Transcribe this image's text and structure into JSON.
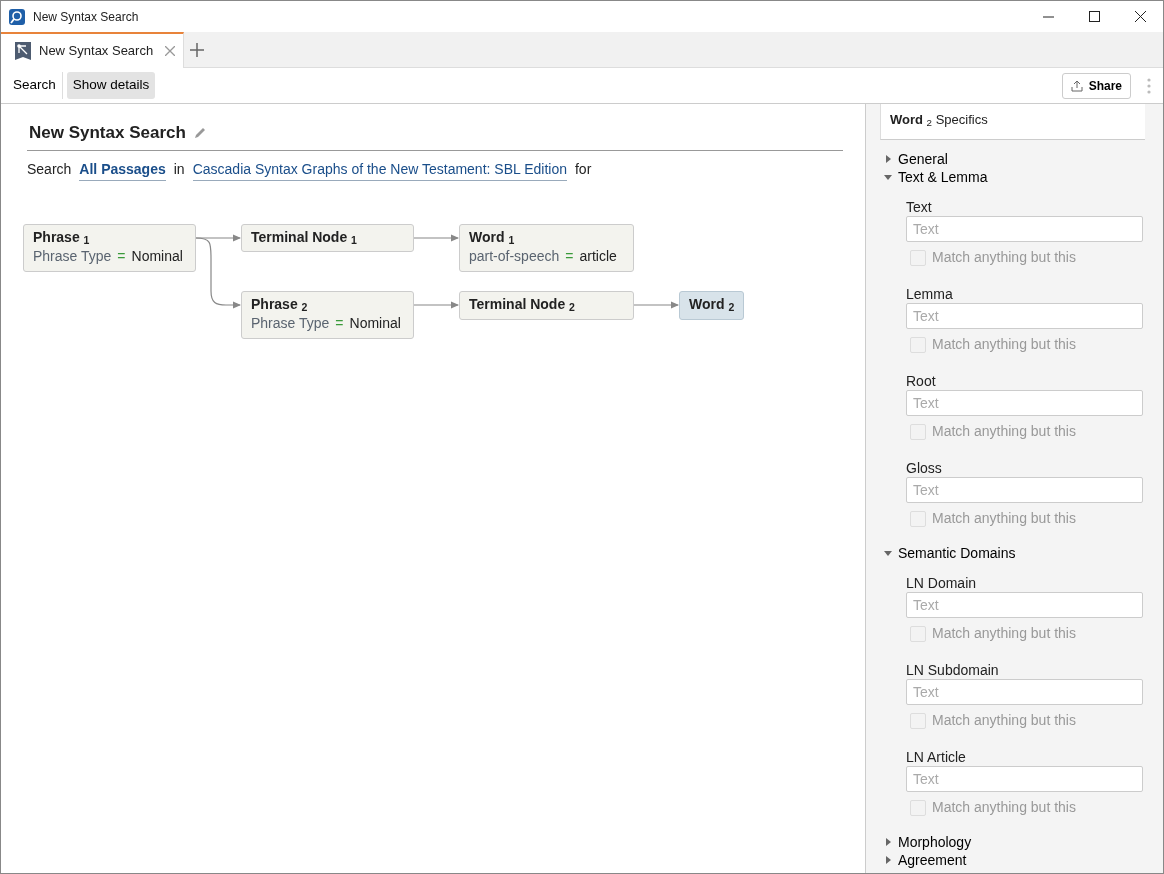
{
  "window": {
    "title": "New Syntax Search"
  },
  "tabs": [
    {
      "label": "New Syntax Search",
      "selected": true
    }
  ],
  "toolbar": {
    "items": [
      {
        "label": "Search",
        "selected": false
      },
      {
        "label": "Show details",
        "selected": true
      }
    ],
    "share": "Share"
  },
  "search": {
    "title": "New Syntax Search",
    "sentence": [
      {
        "kind": "text",
        "text": "Search"
      },
      {
        "kind": "link",
        "text": "All Passages",
        "bold": true
      },
      {
        "kind": "text",
        "text": "in"
      },
      {
        "kind": "link",
        "text": "Cascadia Syntax Graphs of the New Testament: SBL Edition",
        "bold": false
      },
      {
        "kind": "text",
        "text": "for"
      }
    ]
  },
  "graph": {
    "nodes": [
      {
        "title": "Phrase $_{1}$",
        "field": "Phrase Type",
        "op": "=",
        "value": "Nominal",
        "selected": false
      },
      {
        "title": "Terminal Node $_{1}$",
        "selected": false
      },
      {
        "title": "Word $_{1}$",
        "field": "part-of-speech",
        "op": "=",
        "value": "article",
        "selected": false
      },
      {
        "title": "Phrase $_{2}$",
        "field": "Phrase Type",
        "op": "=",
        "value": "Nominal",
        "selected": false
      },
      {
        "title": "Terminal Node $_{2}$",
        "selected": false
      },
      {
        "title": "Word $_{2}$",
        "selected": true
      }
    ]
  },
  "panel": {
    "title": "**Word** $_{2}$ Specifics",
    "sections": [
      {
        "label": "General",
        "expanded": false
      },
      {
        "label": "Text & Lemma",
        "expanded": true,
        "fields": [
          {
            "label": "Text",
            "placeholder": "Text",
            "option": "Match anything but this",
            "checked": false,
            "disabled": true
          },
          {
            "label": "Lemma",
            "placeholder": "Text",
            "option": "Match anything but this",
            "checked": false,
            "disabled": true
          },
          {
            "label": "Root",
            "placeholder": "Text",
            "option": "Match anything but this",
            "checked": false,
            "disabled": true
          },
          {
            "label": "Gloss",
            "placeholder": "Text",
            "option": "Match anything but this",
            "checked": false,
            "disabled": true
          }
        ]
      },
      {
        "label": "Semantic Domains",
        "expanded": true,
        "fields": [
          {
            "label": "LN Domain",
            "placeholder": "Text",
            "option": "Match anything but this",
            "checked": false,
            "disabled": true
          },
          {
            "label": "LN Subdomain",
            "placeholder": "Text",
            "option": "Match anything but this",
            "checked": false,
            "disabled": true
          },
          {
            "label": "LN Article",
            "placeholder": "Text",
            "option": "Match anything but this",
            "checked": false,
            "disabled": true
          }
        ]
      },
      {
        "label": "Morphology",
        "expanded": false
      },
      {
        "label": "Agreement",
        "expanded": false
      }
    ]
  }
}
